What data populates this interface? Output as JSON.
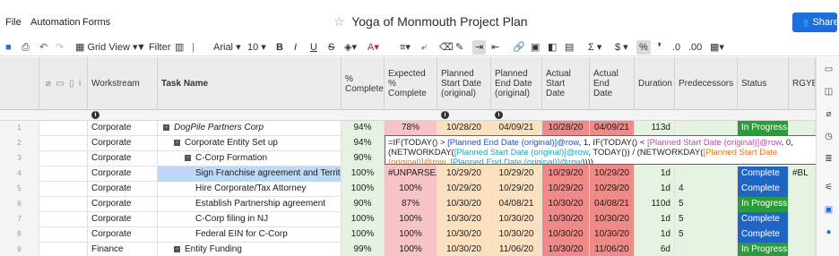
{
  "menu": {
    "file": "File",
    "automation": "Automation",
    "forms": "Forms"
  },
  "title": "Yoga of Monmouth Project Plan",
  "share_label": "Share",
  "toolbar": {
    "grid_view": "Grid View",
    "filter": "Filter",
    "font": "Arial",
    "font_size": "10",
    "bold": "B",
    "italic": "I",
    "underline": "U",
    "strike": "S",
    "sigma": "Σ",
    "currency": "$",
    "percent": "%",
    "comma": "❜",
    "dec_down": ".0",
    "dec_up": ".00"
  },
  "columns": [
    {
      "key": "workstream",
      "label": "Workstream"
    },
    {
      "key": "task",
      "label": "Task Name"
    },
    {
      "key": "pct",
      "label": "% Complete..."
    },
    {
      "key": "exp",
      "label": "Expected % Complete"
    },
    {
      "key": "pstart",
      "label": "Planned Start Date (original)"
    },
    {
      "key": "pend",
      "label": "Planned End Date (original)"
    },
    {
      "key": "astart",
      "label": "Actual Start Date"
    },
    {
      "key": "aend",
      "label": "Actual End Date"
    },
    {
      "key": "dur",
      "label": "Duration"
    },
    {
      "key": "pred",
      "label": "Predecessors"
    },
    {
      "key": "status",
      "label": "Status"
    },
    {
      "key": "rgyb",
      "label": "RGYB"
    }
  ],
  "rows": [
    {
      "num": "1",
      "workstream": "Corporate",
      "task": "DogPile Partners Corp",
      "indent": 0,
      "toggle": "-",
      "italic": true,
      "pct": "94%",
      "exp": "78%",
      "pstart": "10/28/20",
      "pend": "04/09/21",
      "astart": "10/28/20",
      "aend": "04/09/21",
      "dur": "113d",
      "pred": "",
      "status": "In Progress",
      "status_type": "progress",
      "rgyb": ""
    },
    {
      "num": "2",
      "workstream": "Corporate",
      "task": "Corporate Entity Set up",
      "indent": 1,
      "toggle": "-",
      "italic": false,
      "pct": "94%",
      "exp": "",
      "pstart": "",
      "pend": "",
      "astart": "",
      "aend": "",
      "dur": "",
      "pred": "",
      "status": "",
      "status_type": "",
      "rgyb": ""
    },
    {
      "num": "3",
      "workstream": "Corporate",
      "task": "C-Corp Formation",
      "indent": 2,
      "toggle": "-",
      "italic": false,
      "pct": "90%",
      "exp": "",
      "pstart": "",
      "pend": "",
      "astart": "",
      "aend": "",
      "dur": "",
      "pred": "",
      "status": "",
      "status_type": "",
      "rgyb": ""
    },
    {
      "num": "4",
      "workstream": "Corporate",
      "task": "Sign Franchise agreement and Territory",
      "indent": 3,
      "toggle": "",
      "italic": false,
      "selected": true,
      "pct": "100%",
      "exp": "#UNPARSEA",
      "pstart": "10/29/20",
      "pend": "10/29/20",
      "astart": "10/29/20",
      "aend": "10/29/20",
      "dur": "1d",
      "pred": "",
      "status": "Complete",
      "status_type": "complete",
      "rgyb": "#BL"
    },
    {
      "num": "5",
      "workstream": "Corporate",
      "task": "Hire Corporate/Tax Attorney",
      "indent": 3,
      "toggle": "",
      "italic": false,
      "pct": "100%",
      "exp": "100%",
      "pstart": "10/29/20",
      "pend": "10/29/20",
      "astart": "10/29/20",
      "aend": "10/29/20",
      "dur": "1d",
      "pred": "4",
      "status": "Complete",
      "status_type": "complete",
      "rgyb": ""
    },
    {
      "num": "6",
      "workstream": "Corporate",
      "task": "Establish Partnership agreement",
      "indent": 3,
      "toggle": "",
      "italic": false,
      "pct": "90%",
      "exp": "87%",
      "pstart": "10/30/20",
      "pend": "04/08/21",
      "astart": "10/30/20",
      "aend": "04/08/21",
      "dur": "110d",
      "pred": "5",
      "status": "In Progress",
      "status_type": "progress",
      "rgyb": ""
    },
    {
      "num": "7",
      "workstream": "Corporate",
      "task": "C-Corp filing in NJ",
      "indent": 3,
      "toggle": "",
      "italic": false,
      "pct": "100%",
      "exp": "100%",
      "pstart": "10/30/20",
      "pend": "10/30/20",
      "astart": "10/30/20",
      "aend": "10/30/20",
      "dur": "1d",
      "pred": "5",
      "status": "Complete",
      "status_type": "complete",
      "rgyb": ""
    },
    {
      "num": "8",
      "workstream": "Corporate",
      "task": "Federal EIN for C-Corp",
      "indent": 3,
      "toggle": "",
      "italic": false,
      "pct": "100%",
      "exp": "100%",
      "pstart": "10/30/20",
      "pend": "10/30/20",
      "astart": "10/30/20",
      "aend": "10/30/20",
      "dur": "1d",
      "pred": "5",
      "status": "Complete",
      "status_type": "complete",
      "rgyb": ""
    },
    {
      "num": "9",
      "workstream": "Finance",
      "task": "Entity Funding",
      "indent": 1,
      "toggle": "-",
      "italic": false,
      "pct": "99%",
      "exp": "100%",
      "pstart": "10/30/20",
      "pend": "11/06/20",
      "astart": "10/30/20",
      "aend": "11/06/20",
      "dur": "6d",
      "pred": "",
      "status": "In Progress",
      "status_type": "progress",
      "rgyb": ""
    }
  ],
  "formula": {
    "p1": "=IF(TODAY() > ",
    "p2": "[Planned End Date (original)]@row",
    "p3": ", 1, IF(TODAY() < ",
    "p4": "[Planned Start Date (original)]@row",
    "p5": ", 0, (NETWORKDAY(",
    "p6": "[Planned Start Date (original)]@row",
    "p7": ", TODAY()) / (NETWORKDAY(",
    "p8": "[Planned Start Date (original)]@row",
    "p9": ", ",
    "p10": "[Planned End Date (original)]@row",
    "p11": "))))"
  },
  "colors": {
    "accent": "#1f6ddd",
    "in_progress": "#2a9d3a",
    "complete": "#1f66c4",
    "behind_red": "#ee8a88",
    "expected_pink": "#f7c3c6",
    "planned_orange": "#fbe1c0",
    "complete_green_bg": "#e6f3e2"
  },
  "rail_icons": [
    "comment-icon",
    "proof-icon",
    "attachment-icon",
    "activity-icon",
    "summary-icon",
    "filter-settings-icon",
    "brandfolder-icon",
    "bulb-icon"
  ]
}
